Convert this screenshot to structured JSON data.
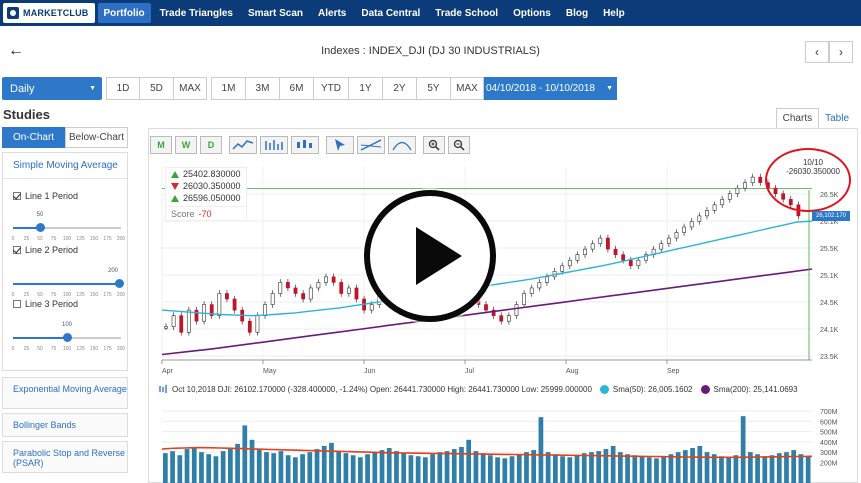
{
  "nav": {
    "logo": "MARKETCLUB",
    "items": [
      {
        "label": "Portfolio",
        "active": true
      },
      {
        "label": "Trade Triangles",
        "active": false
      },
      {
        "label": "Smart Scan",
        "active": false
      },
      {
        "label": "Alerts",
        "active": false
      },
      {
        "label": "Data Central",
        "active": false
      },
      {
        "label": "Trade School",
        "active": false
      },
      {
        "label": "Options",
        "active": false
      },
      {
        "label": "Blog",
        "active": false
      },
      {
        "label": "Help",
        "active": false
      }
    ]
  },
  "header": {
    "title": "Indexes : INDEX_DJI (DJ 30 INDUSTRIALS)",
    "prev": "‹",
    "next": "›"
  },
  "period": {
    "selected": "Daily",
    "group1": [
      "1D",
      "5D",
      "MAX"
    ],
    "group2": [
      "1M",
      "3M",
      "6M",
      "YTD",
      "1Y",
      "2Y",
      "5Y",
      "MAX"
    ],
    "date_range": "04/10/2018 - 10/10/2018"
  },
  "studies": {
    "title": "Studies",
    "tabs": [
      "On-Chart",
      "Below-Chart"
    ],
    "sma": {
      "header": "Simple Moving Average",
      "lines": [
        {
          "label": "Line 1 Period",
          "checked": true,
          "value": 50
        },
        {
          "label": "Line 2 Period",
          "checked": true,
          "value": 200
        },
        {
          "label": "Line 3 Period",
          "checked": false,
          "value": 100
        }
      ],
      "ticks": [
        "0",
        "25",
        "50",
        "75",
        "100",
        "125",
        "150",
        "175",
        "200"
      ]
    },
    "others": [
      "Exponential Moving Average",
      "Bollinger Bands",
      "Parabolic Stop and Reverse (PSAR)"
    ]
  },
  "view_tabs": [
    "Charts",
    "Table"
  ],
  "toolbar": {
    "triangles": [
      "M",
      "W",
      "D"
    ],
    "zoom_in": "+",
    "zoom_out": "−"
  },
  "signals": {
    "rows": [
      {
        "dir": "up",
        "value": "25402.830000"
      },
      {
        "dir": "down",
        "value": "26030.350000"
      },
      {
        "dir": "up",
        "value": "26596.050000"
      }
    ],
    "score_label": "Score",
    "score_value": "-70"
  },
  "tooltip": {
    "date": "10/10",
    "value": "-26030.350000"
  },
  "last_price": "26,102.170",
  "legend": {
    "ohlc": "Oct 10,2018 DJI: 26102.170000 (-328.400000, -1.24%) Open: 26441.730000 High: 26441.730000 Low: 25999.000000",
    "sma50": "Sma(50): 26,005.1602",
    "sma200": "Sma(200): 25,141.0693"
  },
  "colors": {
    "nav_bg": "#0c3b7a",
    "accent": "#2d78c8",
    "up": "#3aa63a",
    "down": "#d42b2b",
    "sma50": "#29b6d6",
    "sma200": "#6a1b7a",
    "volume": "#2f7fa8",
    "volume_avg": "#e0421b"
  },
  "chart_data": {
    "type": "line",
    "title": "",
    "x_ticks": [
      "Apr",
      "May",
      "Jun",
      "Jul",
      "Aug",
      "Sep"
    ],
    "y_ticks": [
      "26.5K",
      "26.1K",
      "25.5K",
      "25.1K",
      "24.5K",
      "24.1K",
      "23.5K"
    ],
    "ylim": [
      23500,
      27000
    ],
    "price_close": [
      24100,
      24300,
      24000,
      24400,
      24200,
      24500,
      24300,
      24700,
      24600,
      24400,
      24200,
      24000,
      24300,
      24500,
      24700,
      24900,
      24800,
      24700,
      24600,
      24800,
      24900,
      25000,
      24900,
      24700,
      24800,
      24600,
      24400,
      24500,
      24700,
      24800,
      24900,
      25100,
      25200,
      25300,
      25200,
      25100,
      25000,
      24900,
      24800,
      24700,
      24600,
      24500,
      24400,
      24300,
      24200,
      24300,
      24500,
      24700,
      24800,
      24900,
      25000,
      25100,
      25200,
      25300,
      25400,
      25500,
      25600,
      25700,
      25500,
      25400,
      25300,
      25200,
      25300,
      25400,
      25500,
      25600,
      25700,
      25800,
      25900,
      26000,
      26100,
      26200,
      26300,
      26400,
      26500,
      26600,
      26700,
      26800,
      26700,
      26600,
      26500,
      26400,
      26300,
      26100
    ],
    "sma50": [
      24400,
      24380,
      24360,
      24340,
      24320,
      24310,
      24300,
      24310,
      24330,
      24350,
      24380,
      24410,
      24440,
      24480,
      24520,
      24560,
      24600,
      24640,
      24680,
      24720,
      24760,
      24800,
      24840,
      24880,
      24920,
      24960,
      25010,
      25060,
      25110,
      25160,
      25210,
      25270,
      25330,
      25390,
      25450,
      25510,
      25570,
      25630,
      25690,
      25750,
      25810,
      25870,
      25930,
      25990,
      26005
    ],
    "sma200": [
      23600,
      23650,
      23700,
      23760,
      23820,
      23880,
      23940,
      24000,
      24060,
      24120,
      24180,
      24240,
      24300,
      24360,
      24420,
      24480,
      24540,
      24600,
      24660,
      24720,
      24780,
      24840,
      24900,
      24960,
      25020,
      25080,
      25141
    ],
    "volume_ylabels": [
      "700M",
      "600M",
      "500M",
      "400M",
      "300M",
      "200M"
    ],
    "volume": [
      290,
      310,
      270,
      330,
      350,
      300,
      280,
      260,
      310,
      340,
      380,
      560,
      420,
      330,
      300,
      290,
      310,
      270,
      250,
      280,
      300,
      330,
      360,
      390,
      310,
      290,
      270,
      250,
      280,
      300,
      320,
      340,
      310,
      290,
      270,
      260,
      250,
      280,
      300,
      310,
      330,
      350,
      420,
      310,
      290,
      270,
      250,
      240,
      260,
      280,
      300,
      320,
      640,
      300,
      280,
      260,
      250,
      270,
      290,
      300,
      310,
      330,
      360,
      300,
      280,
      270,
      260,
      250,
      240,
      260,
      280,
      300,
      320,
      340,
      360,
      300,
      280,
      260,
      250,
      270,
      650,
      300,
      280,
      260,
      270,
      290,
      300,
      320,
      280,
      260
    ],
    "volume_avg": [
      330,
      335,
      338,
      340,
      342,
      344,
      343,
      342,
      340,
      338,
      336,
      334,
      332,
      330,
      328,
      326,
      324,
      322,
      320,
      318,
      316,
      314,
      312,
      310,
      308,
      306,
      304,
      302,
      300,
      298,
      296,
      294,
      293,
      292,
      291,
      290,
      289,
      288,
      287,
      286,
      285,
      284,
      283,
      282,
      281,
      280,
      279,
      278,
      277,
      276,
      275,
      274,
      273,
      272,
      271,
      270,
      269,
      268,
      267,
      266,
      265,
      264,
      263,
      262,
      261,
      260,
      259,
      258,
      257,
      256,
      255,
      254,
      253,
      252,
      251,
      250,
      250,
      250,
      250,
      250,
      251,
      252,
      253,
      254,
      255,
      256,
      257,
      258,
      259,
      260
    ]
  }
}
